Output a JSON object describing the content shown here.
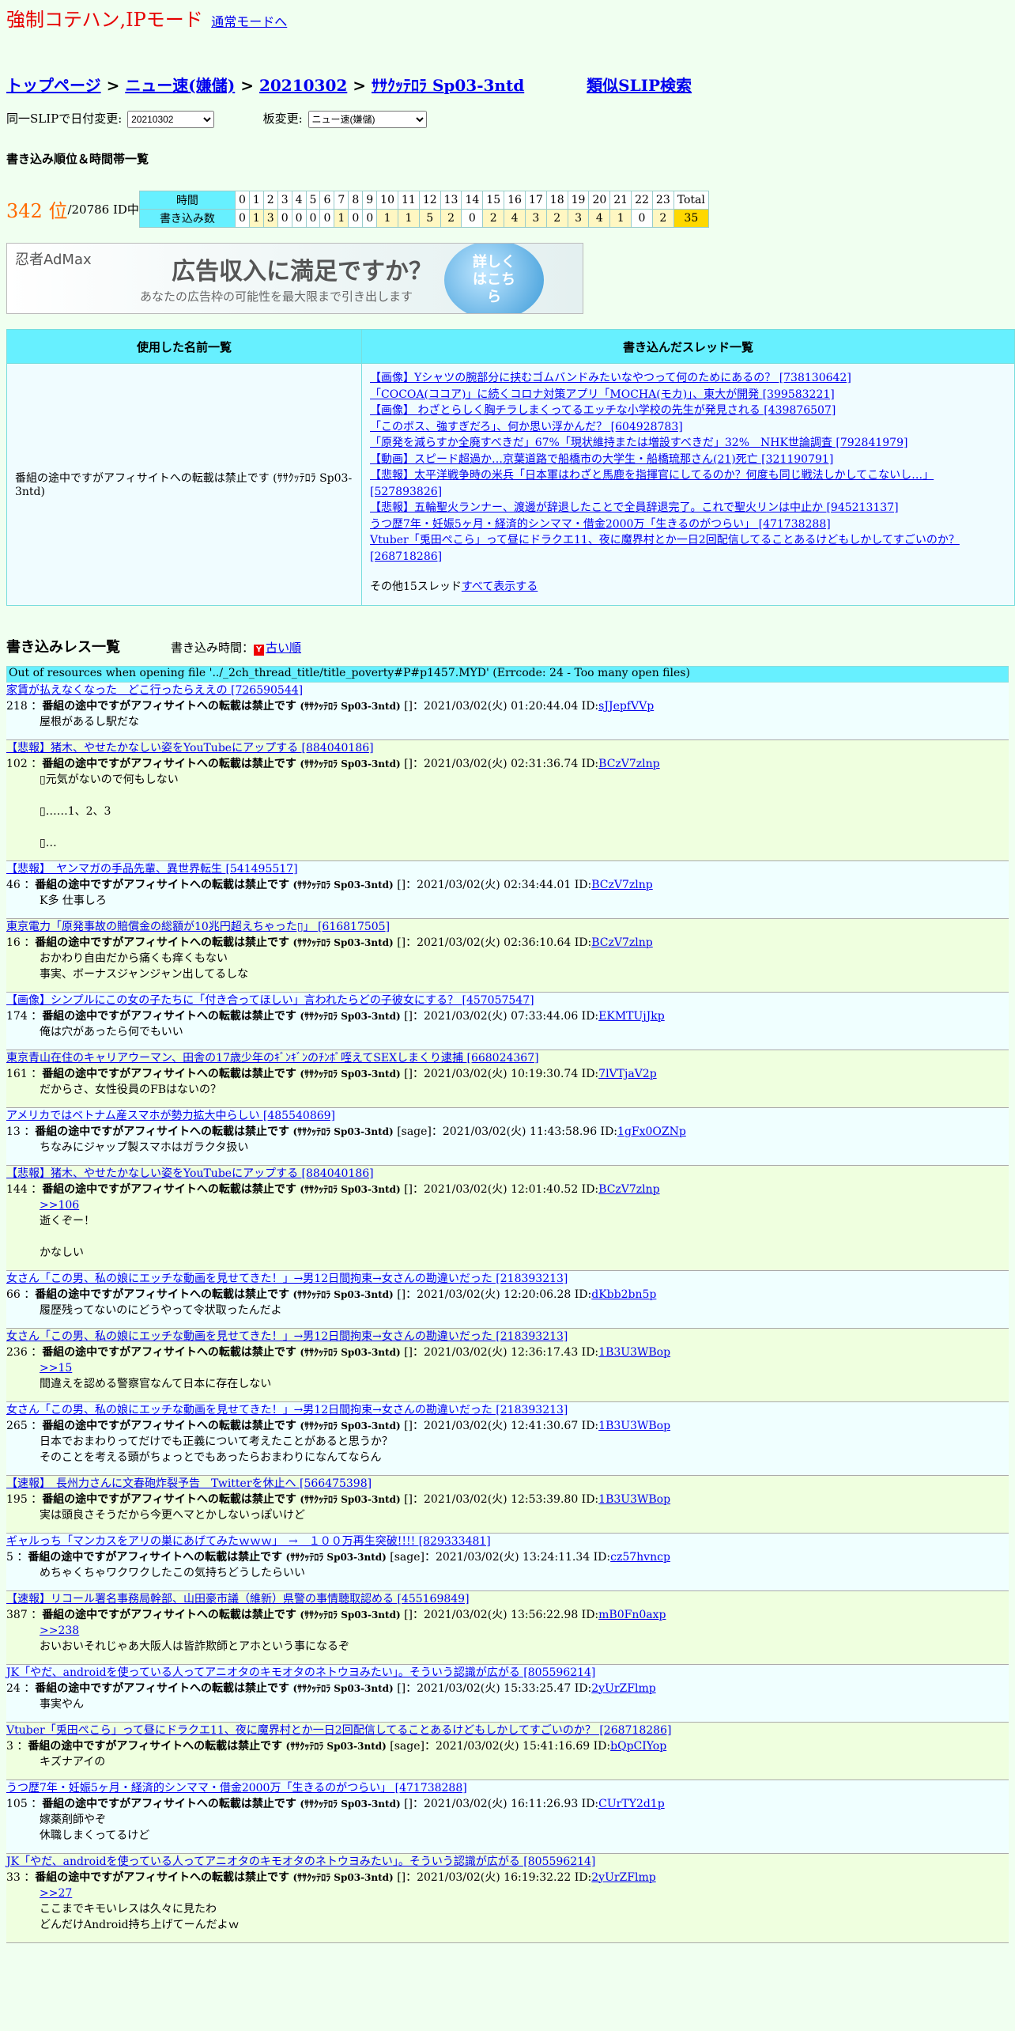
{
  "mode": {
    "title": "強制コテハン,IPモード",
    "link": "通常モードへ"
  },
  "breadcrumb": {
    "items": [
      "トップページ",
      "ニュー速(嫌儲)",
      "20210302",
      "ｻｻｸｯﾃﾛﾗ Sp03-3ntd"
    ],
    "separator": ">",
    "similar": "類似SLIP検索"
  },
  "selectors": {
    "date_label": "同一SLIPで日付変更:",
    "date_value": "20210302",
    "board_label": "板変更:",
    "board_value": "ニュー速(嫌儲)"
  },
  "ranking": {
    "heading": "書き込み順位＆時間帯一覧",
    "rank": "342 位",
    "total": "/20786 ID中",
    "time_label": "時間",
    "count_label": "書き込み数",
    "hours": [
      "0",
      "1",
      "2",
      "3",
      "4",
      "5",
      "6",
      "7",
      "8",
      "9",
      "10",
      "11",
      "12",
      "13",
      "14",
      "15",
      "16",
      "17",
      "18",
      "19",
      "20",
      "21",
      "22",
      "23"
    ],
    "counts": [
      0,
      1,
      3,
      0,
      0,
      0,
      0,
      1,
      0,
      0,
      1,
      1,
      5,
      2,
      0,
      2,
      4,
      3,
      2,
      3,
      4,
      1,
      0,
      2
    ],
    "total_label": "Total",
    "total_value": "35"
  },
  "ad": {
    "logo": "忍者AdMax",
    "headline": "広告収入に満足ですか？",
    "sub": "あなたの広告枠の可能性を最大限まで引き出します",
    "button": "詳しくはこちら"
  },
  "names_table": {
    "col1": "使用した名前一覧",
    "col2": "書き込んだスレッド一覧",
    "name": "番組の途中ですがアフィサイトへの転載は禁止です (ｻｻｸｯﾃﾛﾗ Sp03-3ntd)",
    "threads": [
      "【画像】Yシャツの腕部分に挟むゴムバンドみたいなやつって何のためにあるの？ [738130642]",
      "「COCOA(ココア)」に続くコロナ対策アプリ「MOCHA(モカ)」、東大が開発 [399583221]",
      "【画像】 わざとらしく胸チラしまくってるエッチな小学校の先生が発見される [439876507]",
      "「このボス、強すぎだろ」、何か思い浮かんだ？ [604928783]",
      "「原発を減らすか全廃すべきだ」67%「現状維持または増設すべきだ」32%　NHK世論調査 [792841979]",
      "【動画】スピード超過か…京葉道路で船橋市の大学生・船橋琉那さん(21)死亡 [321190791]",
      "【悲報】太平洋戦争時の米兵「日本軍はわざと馬鹿を指揮官にしてるのか？何度も同じ戦法しかしてこないし…」 [527893826]",
      "【悲報】五輪聖火ランナー、渡邊が辞退したことで全員辞退完了。これで聖火リンは中止か [945213137]",
      "うつ歴7年・妊娠5ヶ月・経済的シンママ・借金2000万「生きるのがつらい」 [471738288]",
      "Vtuber「兎田ぺこら」って昼にドラクエ11、夜に魔界村とか一日2回配信してることあるけどもしかしてすごいのか？ [268718286]"
    ],
    "other_prefix": "その他15スレッド",
    "other_link": "すべて表示する"
  },
  "posts_header": {
    "title": "書き込みレス一覧",
    "time_label": "書き込み時間：",
    "order_icon": "Y",
    "order_link": "古い順"
  },
  "error": "Out of resources when opening file '../_2ch_thread_title/title_poverty#P#p1457.MYD' (Errcode: 24 - Too many open files)",
  "posts": [
    {
      "thread": "家賃が払えなくなった　どこ行ったらええの [726590544]",
      "num": "218",
      "name": "番組の途中ですがアフィサイトへの転載は禁止です",
      "trip": "(ｻｻｸｯﾃﾛﾗ Sp03-3ntd)",
      "meta": "[]：2021/03/02(火) 01:20:44.04 ID:",
      "id": "sJJepfVVp",
      "anchor": "",
      "body": "屋根があるし駅だな",
      "color": "c"
    },
    {
      "thread": "【悲報】猪木、やせたかなしい姿をYouTubeにアップする [884040186]",
      "num": "102",
      "name": "番組の途中ですがアフィサイトへの転載は禁止です",
      "trip": "(ｻｻｸｯﾃﾛﾗ Sp03-3ntd)",
      "meta": "[]：2021/03/02(火) 02:31:36.74 ID:",
      "id": "BCzV7zlnp",
      "anchor": "",
      "body": "▯元気がないので何もしない\n\n▯……1、2、3\n\n▯…",
      "color": "g"
    },
    {
      "thread": "【悲報】　ヤンマガの手品先輩、異世界転生 [541495517]",
      "num": "46",
      "name": "番組の途中ですがアフィサイトへの転載は禁止です",
      "trip": "(ｻｻｸｯﾃﾛﾗ Sp03-3ntd)",
      "meta": "[]：2021/03/02(火) 02:34:44.01 ID:",
      "id": "BCzV7zlnp",
      "anchor": "",
      "body": "K多 仕事しろ",
      "color": "c"
    },
    {
      "thread": "東京電力「原発事故の賠償金の総額が10兆円超えちゃった▯」 [616817505]",
      "num": "16",
      "name": "番組の途中ですがアフィサイトへの転載は禁止です",
      "trip": "(ｻｻｸｯﾃﾛﾗ Sp03-3ntd)",
      "meta": "[]：2021/03/02(火) 02:36:10.64 ID:",
      "id": "BCzV7zlnp",
      "anchor": "",
      "body": "おかわり自由だから痛くも痒くもない\n事実、ボーナスジャンジャン出してるしな",
      "color": "g"
    },
    {
      "thread": "【画像】シンプルにこの女の子たちに「付き合ってほしい」言われたらどの子彼女にする？ [457057547]",
      "num": "174",
      "name": "番組の途中ですがアフィサイトへの転載は禁止です",
      "trip": "(ｻｻｸｯﾃﾛﾗ Sp03-3ntd)",
      "meta": "[]：2021/03/02(火) 07:33:44.06 ID:",
      "id": "EKMTUjJkp",
      "anchor": "",
      "body": "俺は穴があったら何でもいい",
      "color": "c"
    },
    {
      "thread": "東京青山在住のキャリアウーマン、田舎の17歳少年のｷﾞﾝｷﾞﾝのﾁﾝﾎﾟ咥えてSEXしまくり逮捕 [668024367]",
      "num": "161",
      "name": "番組の途中ですがアフィサイトへの転載は禁止です",
      "trip": "(ｻｻｸｯﾃﾛﾗ Sp03-3ntd)",
      "meta": "[]：2021/03/02(火) 10:19:30.74 ID:",
      "id": "7lVTjaV2p",
      "anchor": "",
      "body": "だからさ、女性役員のFBはないの？",
      "color": "g"
    },
    {
      "thread": "アメリカではベトナム産スマホが勢力拡大中らしい [485540869]",
      "num": "13",
      "name": "番組の途中ですがアフィサイトへの転載は禁止です",
      "trip": "(ｻｻｸｯﾃﾛﾗ Sp03-3ntd)",
      "meta": "[sage]：2021/03/02(火) 11:43:58.96 ID:",
      "id": "1gFx0OZNp",
      "anchor": "",
      "body": "ちなみにジャップ製スマホはガラクタ扱い",
      "color": "c"
    },
    {
      "thread": "【悲報】猪木、やせたかなしい姿をYouTubeにアップする [884040186]",
      "num": "144",
      "name": "番組の途中ですがアフィサイトへの転載は禁止です",
      "trip": "(ｻｻｸｯﾃﾛﾗ Sp03-3ntd)",
      "meta": "[]：2021/03/02(火) 12:01:40.52 ID:",
      "id": "BCzV7zlnp",
      "anchor": ">>106",
      "body": "逝くぞー！\n\nかなしい",
      "color": "g"
    },
    {
      "thread": "女さん「この男、私の娘にエッチな動画を見せてきた！」→男12日間拘束→女さんの勘違いだった [218393213]",
      "num": "66",
      "name": "番組の途中ですがアフィサイトへの転載は禁止です",
      "trip": "(ｻｻｸｯﾃﾛﾗ Sp03-3ntd)",
      "meta": "[]：2021/03/02(火) 12:20:06.28 ID:",
      "id": "dKbb2bn5p",
      "anchor": "",
      "body": "履歴残ってないのにどうやって令状取ったんだよ",
      "color": "c"
    },
    {
      "thread": "女さん「この男、私の娘にエッチな動画を見せてきた！」→男12日間拘束→女さんの勘違いだった [218393213]",
      "num": "236",
      "name": "番組の途中ですがアフィサイトへの転載は禁止です",
      "trip": "(ｻｻｸｯﾃﾛﾗ Sp03-3ntd)",
      "meta": "[]：2021/03/02(火) 12:36:17.43 ID:",
      "id": "1B3U3WBop",
      "anchor": ">>15",
      "body": "間違えを認める警察官なんて日本に存在しない",
      "color": "g"
    },
    {
      "thread": "女さん「この男、私の娘にエッチな動画を見せてきた！」→男12日間拘束→女さんの勘違いだった [218393213]",
      "num": "265",
      "name": "番組の途中ですがアフィサイトへの転載は禁止です",
      "trip": "(ｻｻｸｯﾃﾛﾗ Sp03-3ntd)",
      "meta": "[]：2021/03/02(火) 12:41:30.67 ID:",
      "id": "1B3U3WBop",
      "anchor": "",
      "body": "日本でおまわりってだけでも正義について考えたことがあると思うか？\nそのことを考える頭がちょっとでもあったらおまわりになんてならん",
      "color": "c"
    },
    {
      "thread": "【速報】　長州力さんに文春砲炸裂予告　Twitterを休止へ [566475398]",
      "num": "195",
      "name": "番組の途中ですがアフィサイトへの転載は禁止です",
      "trip": "(ｻｻｸｯﾃﾛﾗ Sp03-3ntd)",
      "meta": "[]：2021/03/02(火) 12:53:39.80 ID:",
      "id": "1B3U3WBop",
      "anchor": "",
      "body": "実は頭良さそうだから今更ヘマとかしないっぽいけど",
      "color": "g"
    },
    {
      "thread": "ギャルっち「マンカスをアリの巣にあげてみたｗｗｗ」　→　１００万再生突破!!!! [829333481]",
      "num": "5",
      "name": "番組の途中ですがアフィサイトへの転載は禁止です",
      "trip": "(ｻｻｸｯﾃﾛﾗ Sp03-3ntd)",
      "meta": "[sage]：2021/03/02(火) 13:24:11.34 ID:",
      "id": "cz57hvncp",
      "anchor": "",
      "body": "めちゃくちゃワクワクしたこの気持ちどうしたらいい",
      "color": "c"
    },
    {
      "thread": "【速報】リコール署名事務局幹部、山田豪市議（維新）県警の事情聴取認める [455169849]",
      "num": "387",
      "name": "番組の途中ですがアフィサイトへの転載は禁止です",
      "trip": "(ｻｻｸｯﾃﾛﾗ Sp03-3ntd)",
      "meta": "[]：2021/03/02(火) 13:56:22.98 ID:",
      "id": "mB0Fn0axp",
      "anchor": ">>238",
      "body": "おいおいそれじゃあ大阪人は皆詐欺師とアホという事になるぞ",
      "color": "g"
    },
    {
      "thread": "JK「やだ、androidを使っている人ってアニオタのキモオタのネトウヨみたい」。そういう認識が広がる [805596214]",
      "num": "24",
      "name": "番組の途中ですがアフィサイトへの転載は禁止です",
      "trip": "(ｻｻｸｯﾃﾛﾗ Sp03-3ntd)",
      "meta": "[]：2021/03/02(火) 15:33:25.47 ID:",
      "id": "2yUrZFlmp",
      "anchor": "",
      "body": "事実やん",
      "color": "c"
    },
    {
      "thread": "Vtuber「兎田ぺこら」って昼にドラクエ11、夜に魔界村とか一日2回配信してることあるけどもしかしてすごいのか？ [268718286]",
      "num": "3",
      "name": "番組の途中ですがアフィサイトへの転載は禁止です",
      "trip": "(ｻｻｸｯﾃﾛﾗ Sp03-3ntd)",
      "meta": "[sage]：2021/03/02(火) 15:41:16.69 ID:",
      "id": "bQpCIYop",
      "anchor": "",
      "body": "キズナアイの",
      "color": "g"
    },
    {
      "thread": "うつ歴7年・妊娠5ヶ月・経済的シンママ・借金2000万「生きるのがつらい」 [471738288]",
      "num": "105",
      "name": "番組の途中ですがアフィサイトへの転載は禁止です",
      "trip": "(ｻｻｸｯﾃﾛﾗ Sp03-3ntd)",
      "meta": "[]：2021/03/02(火) 16:11:26.93 ID:",
      "id": "CUrTY2d1p",
      "anchor": "",
      "body": "嫁薬剤師やぞ\n休職しまくってるけど",
      "color": "c"
    },
    {
      "thread": "JK「やだ、androidを使っている人ってアニオタのキモオタのネトウヨみたい」。そういう認識が広がる [805596214]",
      "num": "33",
      "name": "番組の途中ですがアフィサイトへの転載は禁止です",
      "trip": "(ｻｻｸｯﾃﾛﾗ Sp03-3ntd)",
      "meta": "[]：2021/03/02(火) 16:19:32.22 ID:",
      "id": "2yUrZFlmp",
      "anchor": ">>27",
      "body": "ここまでキモいレスは久々に見たわ\nどんだけAndroid持ち上げてーんだよｗ",
      "color": "g"
    }
  ]
}
